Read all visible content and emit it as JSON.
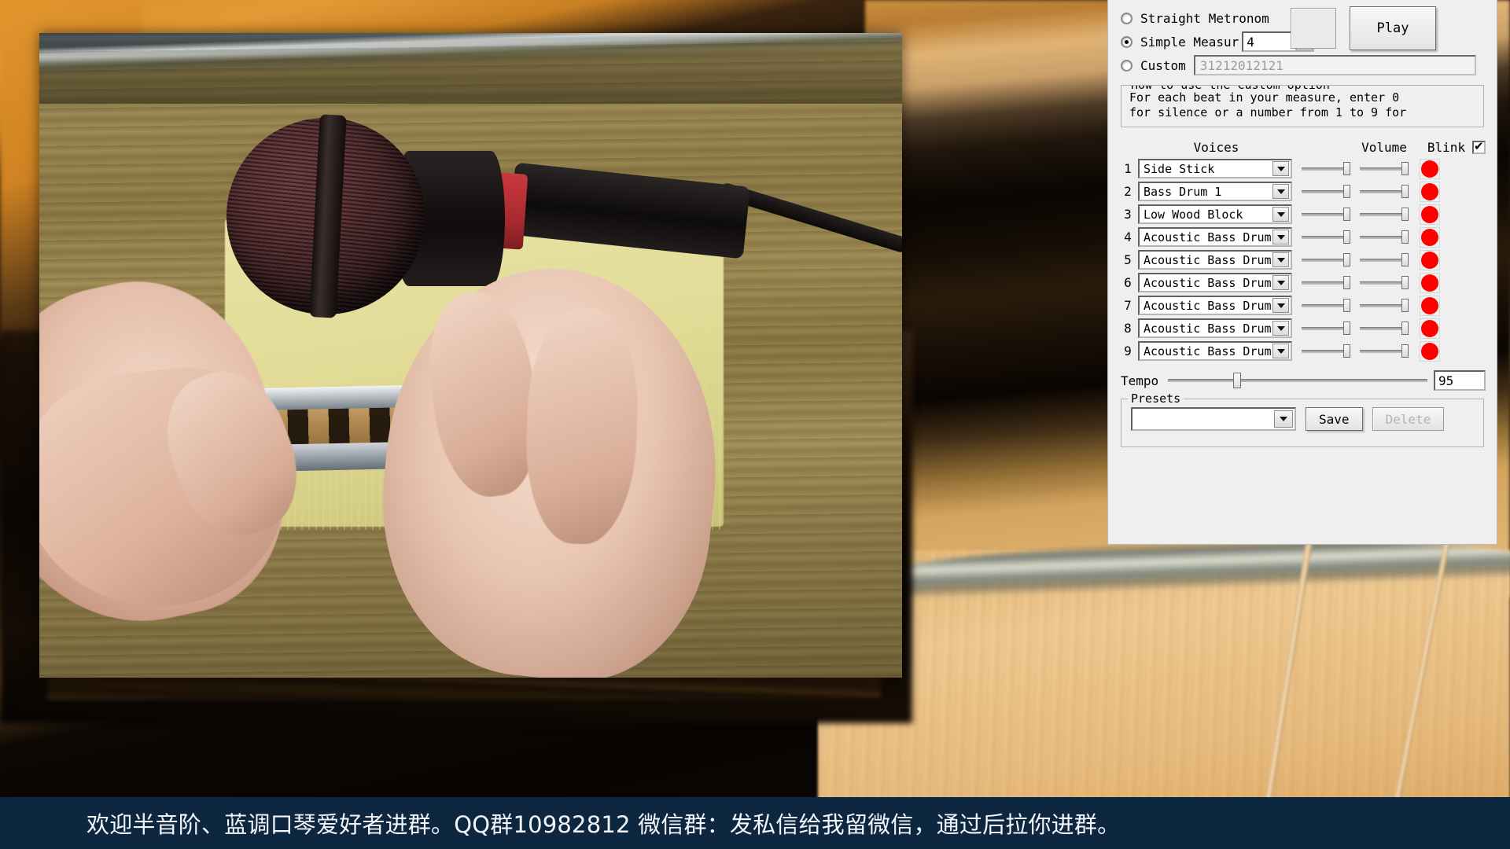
{
  "metronome": {
    "modes": [
      {
        "label": "Straight Metronom",
        "selected": false,
        "name": "straight-metronome"
      },
      {
        "label": "Simple Measur",
        "selected": true,
        "name": "simple-measure"
      },
      {
        "label": "Custom",
        "selected": false,
        "name": "custom"
      }
    ],
    "measure_beats": "4",
    "custom_pattern": "31212012121",
    "play_label": "Play",
    "howto": {
      "title": "How to use the Custom option",
      "lines": [
        "For each beat in your measure, enter 0",
        "for silence or a number from 1 to 9 for"
      ]
    },
    "headers": {
      "voices": "Voices",
      "volume": "Volume",
      "blink": "Blink",
      "blink_checked": true
    },
    "voices": [
      {
        "num": "1",
        "instrument": "Side Stick",
        "volume": 100,
        "pan": 100,
        "active": true
      },
      {
        "num": "2",
        "instrument": "Bass Drum 1",
        "volume": 100,
        "pan": 100,
        "active": true
      },
      {
        "num": "3",
        "instrument": "Low Wood Block",
        "volume": 100,
        "pan": 100,
        "active": true
      },
      {
        "num": "4",
        "instrument": "Acoustic Bass Drum",
        "volume": 100,
        "pan": 100,
        "active": true
      },
      {
        "num": "5",
        "instrument": "Acoustic Bass Drum",
        "volume": 100,
        "pan": 100,
        "active": true
      },
      {
        "num": "6",
        "instrument": "Acoustic Bass Drum",
        "volume": 100,
        "pan": 100,
        "active": true
      },
      {
        "num": "7",
        "instrument": "Acoustic Bass Drum",
        "volume": 100,
        "pan": 100,
        "active": true
      },
      {
        "num": "8",
        "instrument": "Acoustic Bass Drum",
        "volume": 100,
        "pan": 100,
        "active": true
      },
      {
        "num": "9",
        "instrument": "Acoustic Bass Drum",
        "volume": 100,
        "pan": 100,
        "active": true
      }
    ],
    "tempo": {
      "label": "Tempo",
      "value": "95",
      "slider_percent": 25
    },
    "presets": {
      "title": "Presets",
      "selected": "",
      "save_label": "Save",
      "delete_label": "Delete",
      "delete_disabled": true
    },
    "colors": {
      "indicator_red": "#FF0000",
      "panel_bg": "#EFEFEF",
      "caption_bg": "#0E2740"
    }
  },
  "caption": {
    "text": "欢迎半音阶、蓝调口琴爱好者进群。QQ群10982812 微信群：发私信给我留微信，通过后拉你进群。"
  },
  "video": {
    "description": "hands-holding-harmonica-near-microphone"
  }
}
